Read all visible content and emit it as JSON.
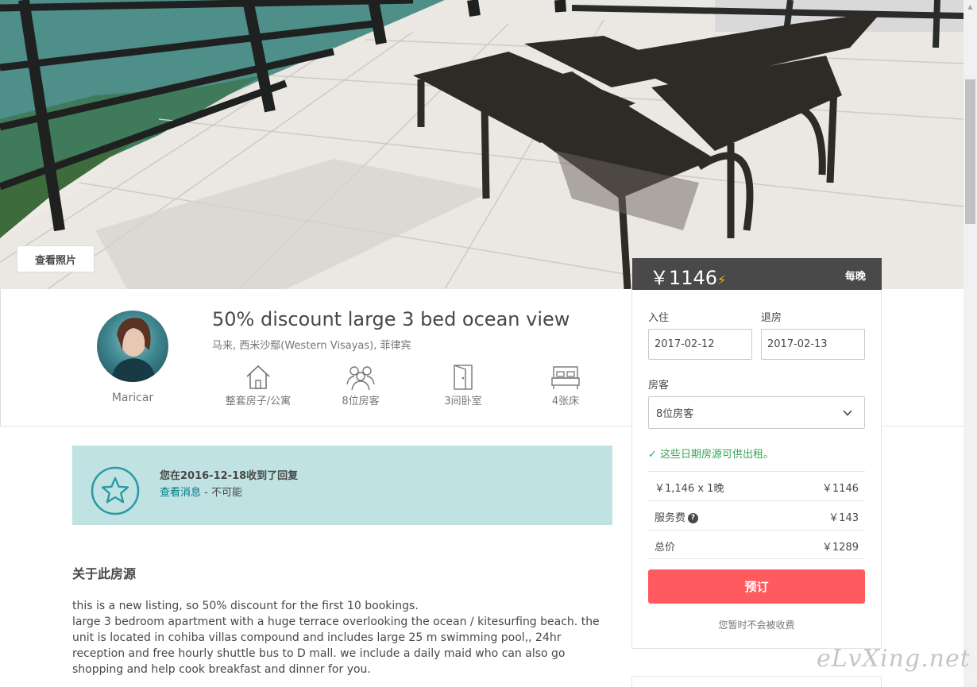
{
  "hero": {
    "view_photos_label": "查看照片"
  },
  "booking": {
    "price": "￥1146",
    "instant_book_icon": "bolt-icon",
    "per_night": "每晚",
    "checkin_label": "入住",
    "checkout_label": "退房",
    "checkin_value": "2017-02-12",
    "checkout_value": "2017-02-13",
    "guests_label": "房客",
    "guests_value": "8位房客",
    "availability": "✓ 这些日期房源可供出租。",
    "fees": [
      {
        "label": "￥1,146 x 1晚",
        "value": "￥1146"
      },
      {
        "label": "服务费",
        "value": "￥143"
      },
      {
        "label": "总价",
        "value": "￥1289"
      }
    ],
    "book_button": "预订",
    "no_charge_note": "您暂时不会被收费"
  },
  "listing": {
    "host_name": "Maricar",
    "title": "50% discount large 3 bed ocean view",
    "location": "马来, 西米沙鄢(Western Visayas), 菲律宾",
    "amenities": [
      {
        "icon": "house-icon",
        "label": "整套房子/公寓"
      },
      {
        "icon": "guests-icon",
        "label": "8位房客"
      },
      {
        "icon": "door-icon",
        "label": "3间卧室"
      },
      {
        "icon": "bed-icon",
        "label": "4张床"
      }
    ]
  },
  "notice": {
    "title": "您在2016-12-18收到了回复",
    "link": "查看消息",
    "suffix": " - 不可能"
  },
  "about": {
    "heading": "关于此房源",
    "lines": [
      "this is a new listing, so 50% discount for the first 10 bookings.",
      "large 3 bedroom apartment with a huge terrace overlooking the ocean / kitesurfing beach. the unit is located in cohiba villas compound and includes large 25 m swimming pool,, 24hr reception and free hourly shuttle bus to D mall. we include a daily maid who can also go shopping and help cook breakfast and dinner for you."
    ]
  },
  "watermark": "eLvXing.net",
  "colors": {
    "accent": "#ff5a5f",
    "link": "#007a87",
    "notice_bg": "#c0e2e3",
    "price_bar": "#494949",
    "available": "#3aa55a"
  }
}
